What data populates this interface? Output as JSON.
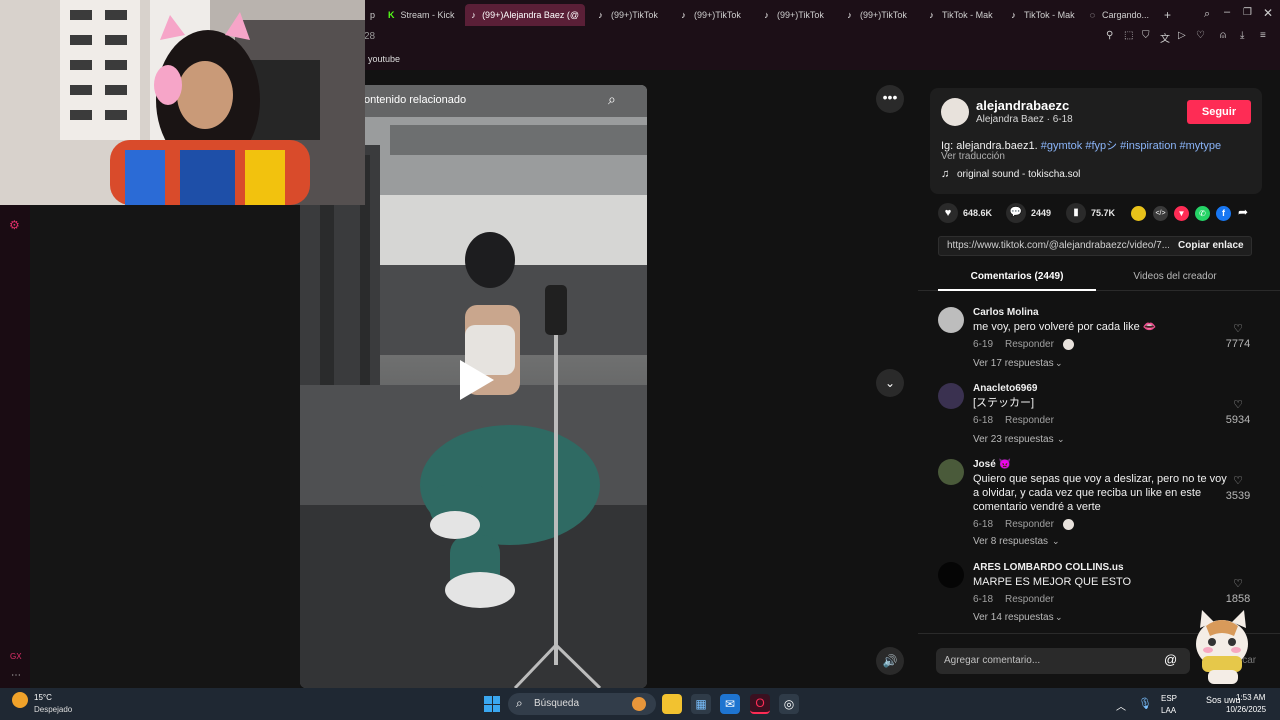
{
  "tabs": [
    {
      "label": "p",
      "icon": "tab-icon"
    },
    {
      "label": "Stream - Kick",
      "icon": "kick-icon"
    },
    {
      "label": "(99+)Alejandra Baez (@",
      "icon": "tiktok-icon",
      "active": true
    },
    {
      "label": "(99+)TikTok",
      "icon": "tiktok-icon"
    },
    {
      "label": "(99+)TikTok",
      "icon": "tiktok-icon"
    },
    {
      "label": "(99+)TikTok",
      "icon": "tiktok-icon"
    },
    {
      "label": "(99+)TikTok",
      "icon": "tiktok-icon"
    },
    {
      "label": "TikTok - Mak",
      "icon": "tiktok-icon"
    },
    {
      "label": "TikTok - Mak",
      "icon": "tiktok-icon"
    },
    {
      "label": "Cargando...",
      "icon": "loading-icon"
    }
  ],
  "address_fragment": "28",
  "bookmark": "youtube",
  "video": {
    "related_label": "ontenido relacionado"
  },
  "sidebar": {
    "bottom_label": "GX"
  },
  "author": {
    "username": "alejandrabaezc",
    "display": "Alejandra Baez · 6-18",
    "follow": "Seguir",
    "caption_prefix": "Ig: alejandra.baez1.",
    "hashtags": "#gymtok #fypシ #inspiration #mytype",
    "translate": "Ver traducción",
    "sound": "original sound - tokischa.sol"
  },
  "actions": {
    "likes": "648.6K",
    "comments": "2449",
    "saves": "75.7K"
  },
  "share_colors": [
    "#e8c21a",
    "#3a3a3a",
    "#fe2c55",
    "#25d366",
    "#1877f2"
  ],
  "link": {
    "url": "https://www.tiktok.com/@alejandrabaezc/video/7...",
    "copy": "Copiar enlace"
  },
  "right_tabs": {
    "comments": "Comentarios (2449)",
    "videos": "Videos del creador"
  },
  "comments": [
    {
      "name": "Carlos Molina",
      "text": "me voy, pero volveré por cada like 👄",
      "date": "6-19",
      "reply": "Responder",
      "replies": "Ver 17 respuestas",
      "likes": "7774"
    },
    {
      "name": "Anacleto6969",
      "text": "[ステッカー]",
      "date": "6-18",
      "reply": "Responder",
      "replies": "Ver 23 respuestas",
      "likes": "5934"
    },
    {
      "name": "José 👿",
      "text": "Quiero que sepas que voy a deslizar, pero no te voy a olvidar, y cada vez que reciba un like en este comentario vendré a verte",
      "date": "6-18",
      "reply": "Responder",
      "replies": "Ver 8 respuestas",
      "likes": "3539"
    },
    {
      "name": "ARES LOMBARDO COLLINS.us",
      "text": "MARPE ES MEJOR QUE ESTO",
      "date": "6-18",
      "reply": "Responder",
      "replies": "Ver 14 respuestas",
      "likes": "1858"
    }
  ],
  "comment_input": {
    "placeholder": "Agregar comentario...",
    "post": "icar"
  },
  "weather": {
    "temp": "15°C",
    "desc": "Despejado"
  },
  "taskbar": {
    "search": "Búsqueda",
    "lang1": "ESP",
    "lang2": "LAA",
    "overlay_text": "Sos uwu",
    "time": "1:53 AM",
    "date": "10/26/2025"
  }
}
